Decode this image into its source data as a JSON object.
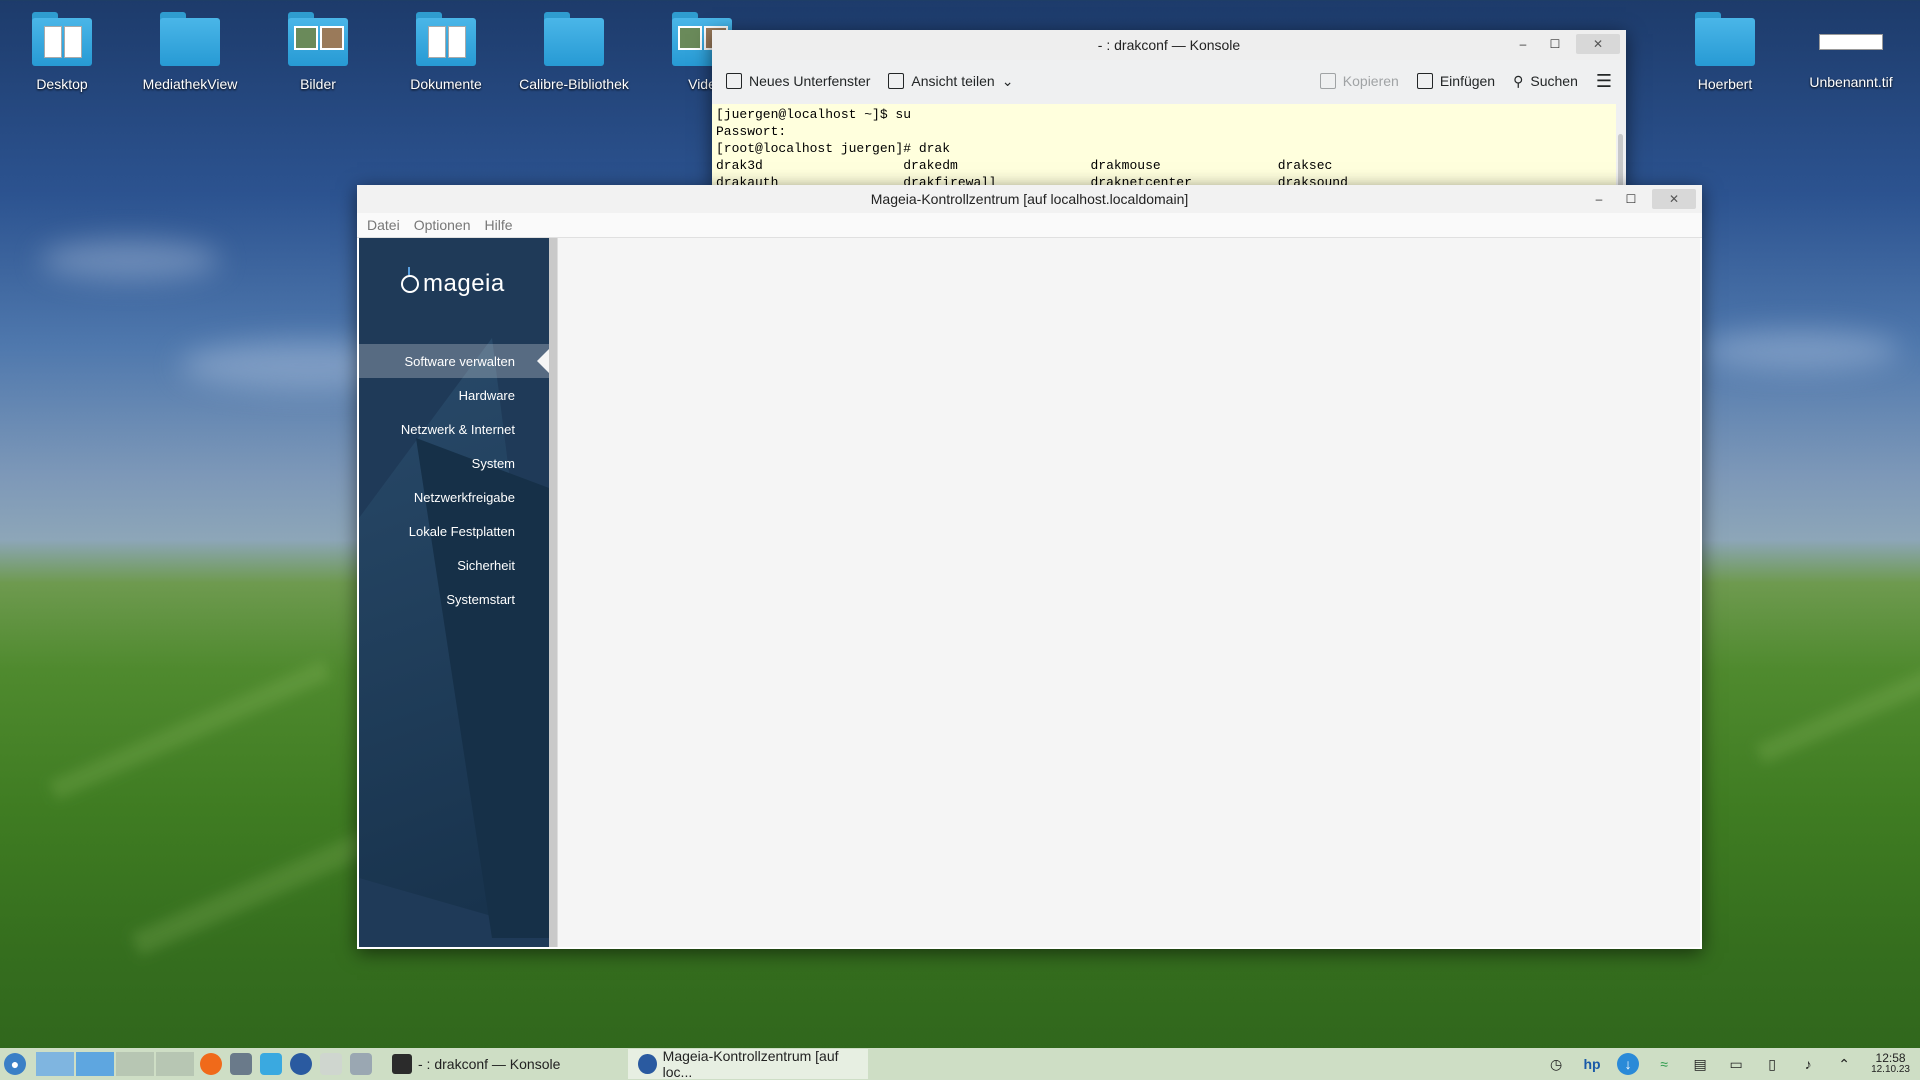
{
  "desktop": {
    "icons": [
      {
        "label": "Desktop",
        "type": "folder-papers"
      },
      {
        "label": "MediathekView",
        "type": "folder"
      },
      {
        "label": "Bilder",
        "type": "folder-photos"
      },
      {
        "label": "Dokumente",
        "type": "folder-papers"
      },
      {
        "label": "Calibre-Bibliothek",
        "type": "folder"
      },
      {
        "label": "Vide",
        "type": "folder-photos"
      },
      {
        "label": "Hoerbert",
        "type": "folder"
      },
      {
        "label": "Unbenannt.tif",
        "type": "file"
      }
    ]
  },
  "konsole": {
    "title": "- : drakconf — Konsole",
    "toolbar": {
      "new_tab": "Neues Unterfenster",
      "split_view": "Ansicht teilen",
      "copy": "Kopieren",
      "paste": "Einfügen",
      "search": "Suchen"
    },
    "terminal_lines": [
      "[juergen@localhost ~]$ su",
      "Passwort:",
      "[root@localhost juergen]# drak",
      "drak3d                  drakedm                 drakmouse               draksec",
      "drakauth                drakfirewall            draknetcenter           draksound"
    ]
  },
  "mcc": {
    "title": "Mageia-Kontrollzentrum [auf localhost.localdomain]",
    "menu": [
      "Datei",
      "Optionen",
      "Hilfe"
    ],
    "logo_text": "mageia",
    "categories": [
      "Software verwalten",
      "Hardware",
      "Netzwerk & Internet",
      "System",
      "Netzwerkfreigabe",
      "Lokale Festplatten",
      "Sicherheit",
      "Systemstart"
    ],
    "selected_category": "Software verwalten"
  },
  "taskbar": {
    "tasks": [
      {
        "label": "- : drakconf — Konsole"
      },
      {
        "label": "Mageia-Kontrollzentrum  [auf loc..."
      }
    ],
    "clock_time": "12:58",
    "clock_date": "12.10.23"
  },
  "colors": {
    "sidebar": "#1f3a58",
    "terminal_bg": "#ffffdd",
    "taskbar": "#dce8d4",
    "folder": "#3aa9e0"
  }
}
